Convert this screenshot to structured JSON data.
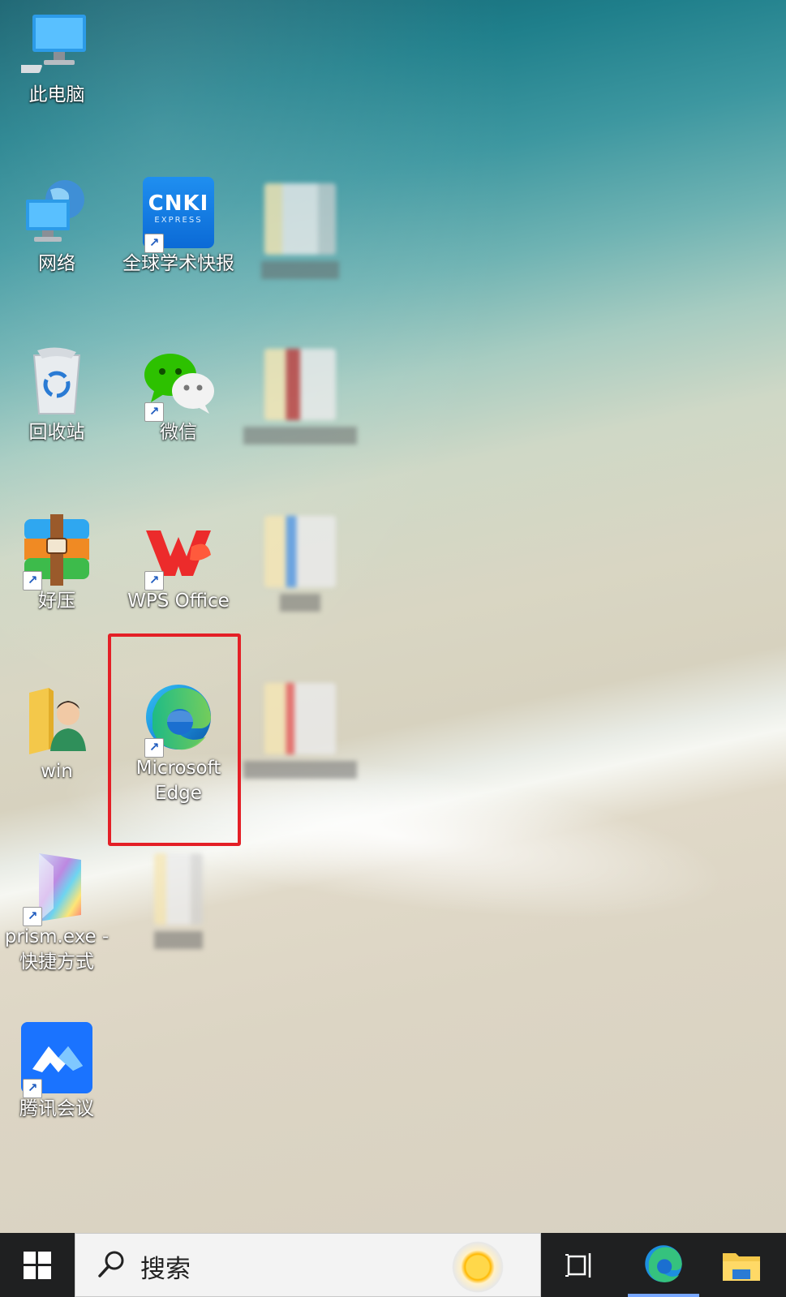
{
  "desktop": {
    "icons": [
      {
        "label": "此电脑",
        "icon": "computer-icon"
      },
      {
        "label": "网络",
        "icon": "network-icon"
      },
      {
        "label": "全球学术快报",
        "icon": "cnki-icon",
        "logo_text": "CNKI",
        "logo_sub": "EXPRESS",
        "shortcut": true
      },
      {
        "label": "回收站",
        "icon": "recycle-bin-icon"
      },
      {
        "label": "微信",
        "icon": "wechat-icon",
        "shortcut": true
      },
      {
        "label": "好压",
        "icon": "haozip-icon",
        "shortcut": true
      },
      {
        "label": "WPS Office",
        "icon": "wps-icon",
        "shortcut": true
      },
      {
        "label": "win",
        "icon": "user-folder-icon"
      },
      {
        "label": "Microsoft Edge",
        "icon": "edge-icon",
        "shortcut": true
      },
      {
        "label": "prism.exe - 快捷方式",
        "icon": "prism-icon",
        "shortcut": true
      },
      {
        "label": "腾讯会议",
        "icon": "tencent-meeting-icon",
        "shortcut": true
      }
    ]
  },
  "taskbar": {
    "search_placeholder": "搜索",
    "items": [
      {
        "icon": "task-view-icon"
      },
      {
        "icon": "edge-icon",
        "active": true
      },
      {
        "icon": "file-explorer-icon"
      }
    ]
  },
  "colors": {
    "highlight": "#e41f26",
    "taskbar": "#1f2021",
    "accent": "#78a7ff"
  }
}
